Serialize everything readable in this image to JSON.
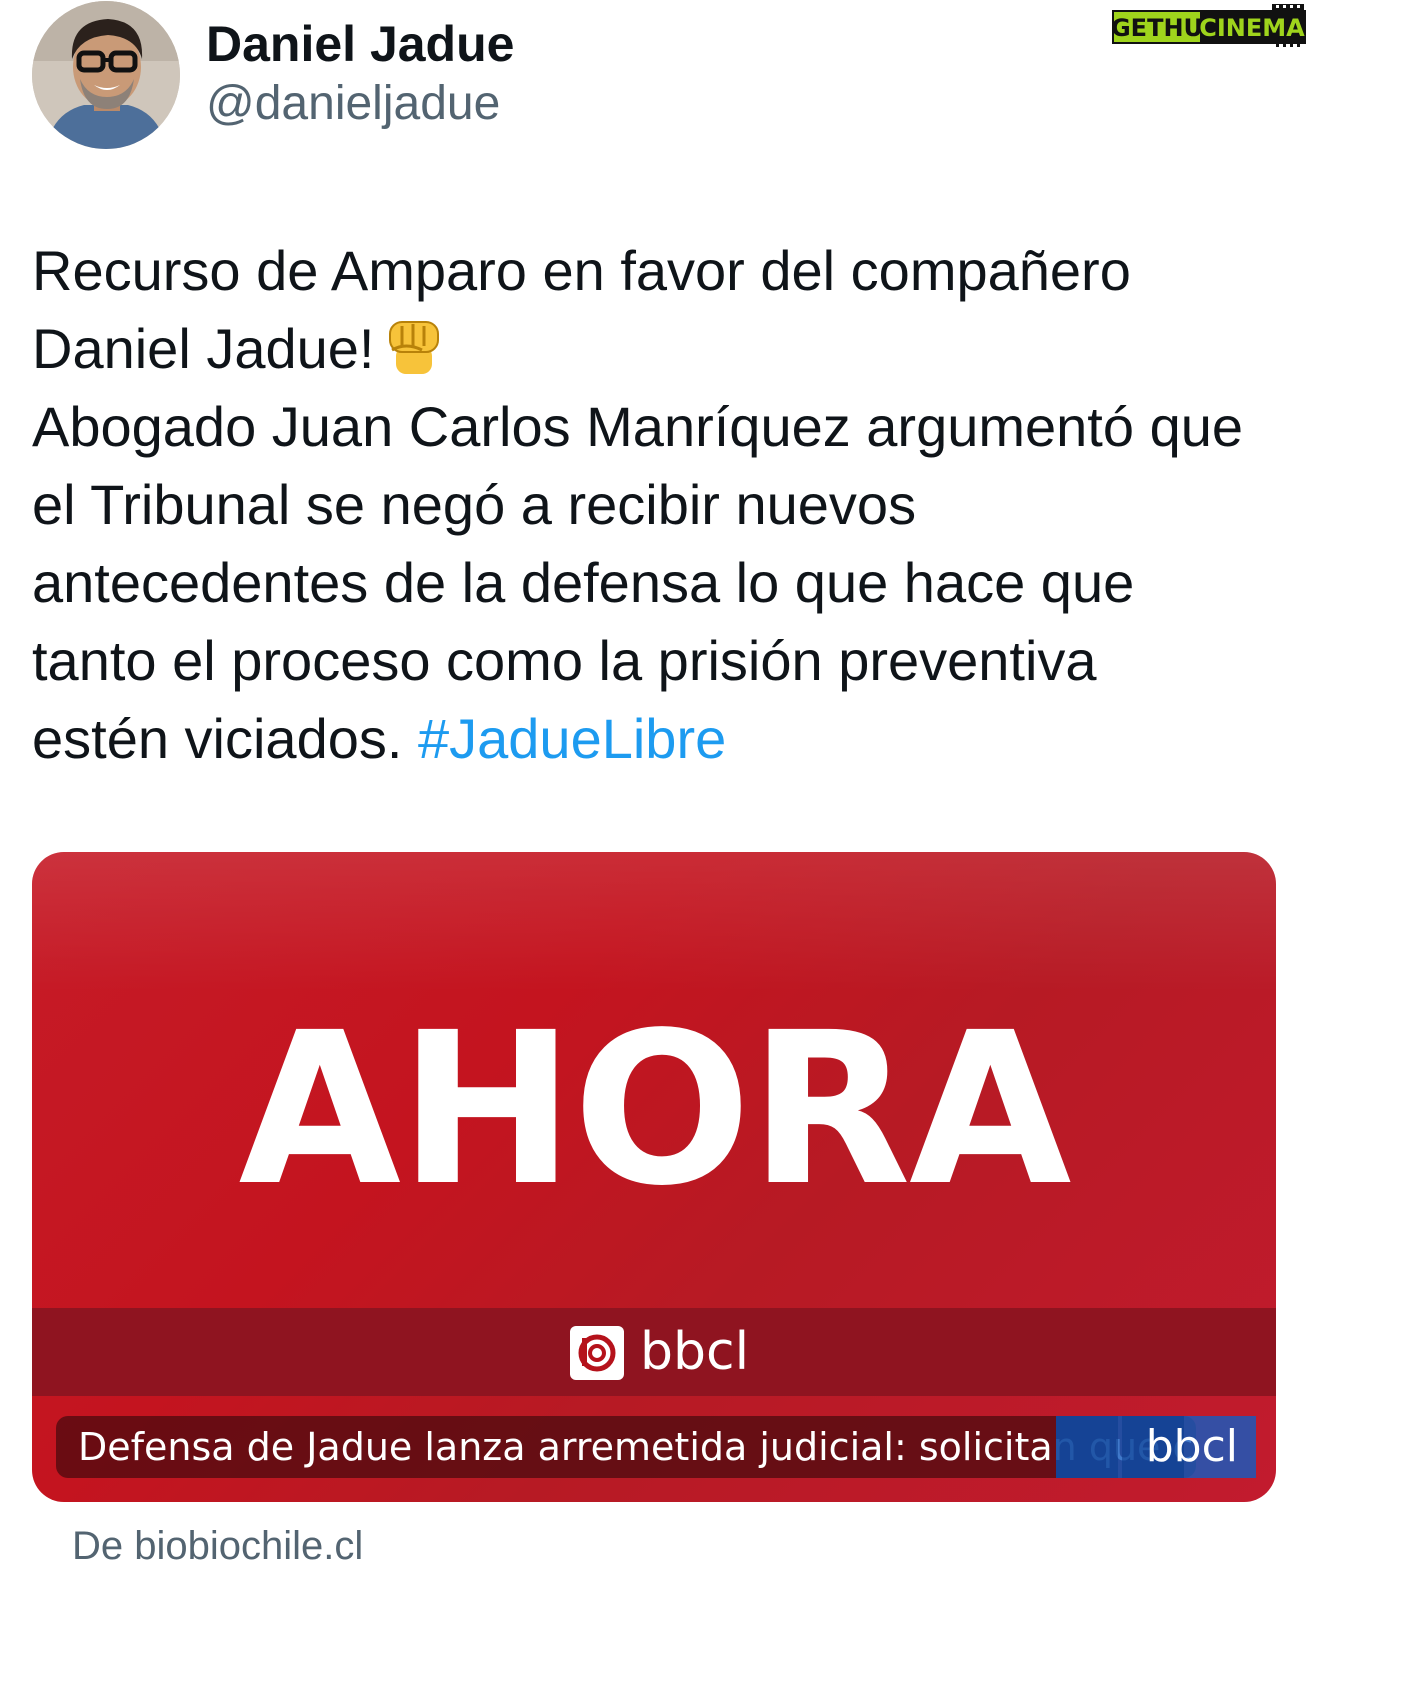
{
  "author": {
    "display_name": "Daniel Jadue",
    "handle": "@danieljadue"
  },
  "watermark": {
    "text_left": "GETHU",
    "text_right": "CINEMA"
  },
  "tweet": {
    "lines": [
      "Recurso de Amparo en favor del compañero",
      "Daniel Jadue!",
      "Abogado Juan Carlos Manríquez argumentó que",
      "el Tribunal se negó a recibir nuevos",
      "antecedentes de la defensa lo que hace que",
      "tanto el proceso como la prisión preventiva",
      "estén viciados."
    ],
    "hashtag": "#JadueLibre",
    "emoji": "raised-fist",
    "colors": {
      "text": "#0f1419",
      "link": "#1d9bf0"
    }
  },
  "card": {
    "headline_image_text": "AHORA",
    "brand": "bbcl",
    "title": "Defensa de Jadue lanza arremetida judicial: solicitan que c...",
    "overlay_brand": "bbcl",
    "colors": {
      "background": "#c4141f",
      "band": "#8f1420"
    }
  },
  "source": {
    "label": "De biobiochile.cl"
  }
}
